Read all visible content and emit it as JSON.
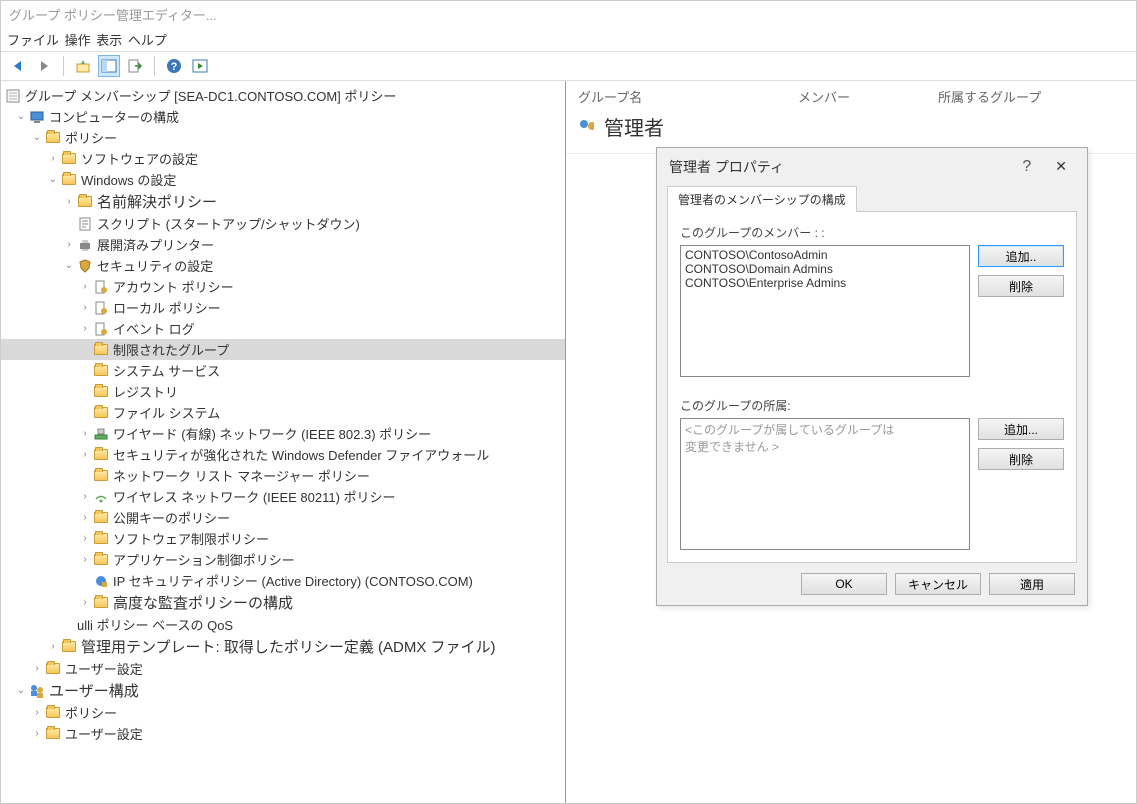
{
  "title": "グループ ポリシー管理エディター...",
  "menu": {
    "file": "ファイル",
    "action": "操作",
    "view": "表示",
    "help": "ヘルプ"
  },
  "tree": {
    "root": "グループ メンバーシップ [SEA-DC1.CONTOSO.COM] ポリシー",
    "computer_cfg": "コンピューターの構成",
    "policies": "ポリシー",
    "sw_settings": "ソフトウェアの設定",
    "win_settings": "Windows の設定",
    "name_res": "名前解決ポリシー",
    "scripts": "スクリプト (スタートアップ/シャットダウン)",
    "printers": "展開済みプリンター",
    "security": "セキュリティの設定",
    "account_pol": "アカウント ポリシー",
    "local_pol": "ローカル ポリシー",
    "event_log": "イベント ログ",
    "restricted_groups": "制限されたグループ",
    "system_svc": "システム サービス",
    "registry": "レジストリ",
    "filesystem": "ファイル システム",
    "wired": "ワイヤード (有線) ネットワーク (IEEE  802.3) ポリシー",
    "defender": "セキュリティが強化された Windows  Defender ファイアウォール",
    "nlm": "ネットワーク リスト マネージャー ポリシー",
    "wireless": "ワイヤレス ネットワーク (IEEE  80211) ポリシー",
    "pubkey": "公開キーのポリシー",
    "sw_restrict": "ソフトウェア制限ポリシー",
    "app_ctrl": "アプリケーション制御ポリシー",
    "ipsec": "IP セキュリティポリシー (Active Directory) (CONTOSO.COM)",
    "adv_audit": "高度な監査ポリシーの構成",
    "qos": "ulli ポリシー ベースの QoS",
    "admx": "管理用テンプレート: 取得したポリシー定義 (ADMX ファイル)",
    "user_settings1": "ユーザー設定",
    "user_cfg": "ユーザー構成",
    "policies2": "ポリシー",
    "user_settings2": "ユーザー設定"
  },
  "right": {
    "col_group": "グループ名",
    "col_member": "メンバー",
    "col_belong": "所属するグループ",
    "group_name": "管理者"
  },
  "dialog": {
    "title": "管理者 プロパティ",
    "tab": "管理者のメンバーシップの構成",
    "members_label": "このグループのメンバー : :",
    "members": [
      "CONTOSO\\ContosoAdmin",
      "CONTOSO\\Domain Admins",
      "CONTOSO\\Enterprise Admins"
    ],
    "belong_label": "このグループの所属:",
    "belong_placeholder1": "<このグループが属しているグループは",
    "belong_placeholder2": "変更できません >",
    "add": "追加..",
    "add2": "追加...",
    "remove": "削除",
    "ok": "OK",
    "cancel": "キャンセル",
    "apply": "適用"
  }
}
